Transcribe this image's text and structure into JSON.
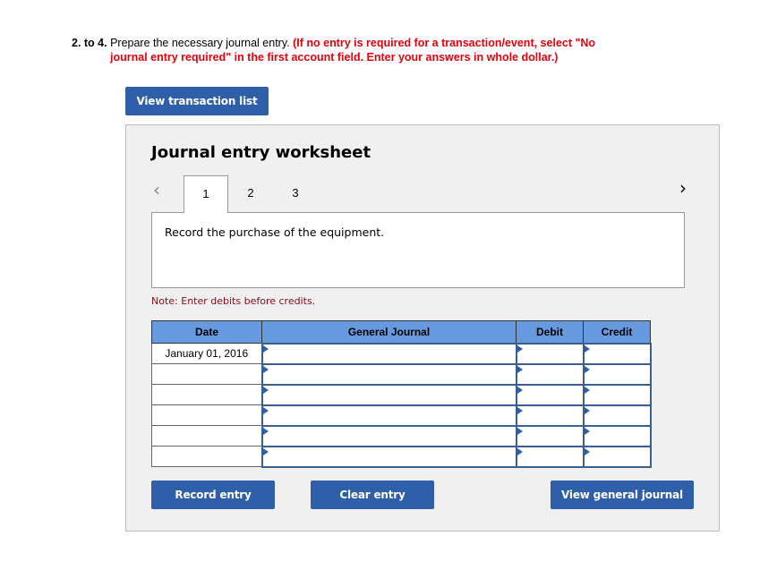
{
  "instructions": {
    "number": "2. to 4.",
    "text": " Prepare the necessary journal entry. ",
    "red_line1": "(If no entry is required for a transaction/event, select \"No",
    "red_line2": "journal entry required\" in the first account field. Enter your answers in whole dollar.)"
  },
  "buttons": {
    "view_transactions": "View transaction list",
    "record_entry": "Record entry",
    "clear_entry": "Clear entry",
    "view_general_journal": "View general journal"
  },
  "worksheet": {
    "title": "Journal entry worksheet",
    "nav_prev_icon": "chevron-left-icon",
    "nav_next_icon": "chevron-right-icon",
    "tabs": [
      {
        "label": "1",
        "active": true
      },
      {
        "label": "2",
        "active": false
      },
      {
        "label": "3",
        "active": false
      }
    ],
    "description": "Record the purchase of the equipment.",
    "note": "Note: Enter debits before credits."
  },
  "table": {
    "headers": [
      "Date",
      "General Journal",
      "Debit",
      "Credit"
    ],
    "rows": [
      {
        "date": "January 01, 2016",
        "account": "",
        "debit": "",
        "credit": ""
      },
      {
        "date": "",
        "account": "",
        "debit": "",
        "credit": ""
      },
      {
        "date": "",
        "account": "",
        "debit": "",
        "credit": ""
      },
      {
        "date": "",
        "account": "",
        "debit": "",
        "credit": ""
      },
      {
        "date": "",
        "account": "",
        "debit": "",
        "credit": ""
      },
      {
        "date": "",
        "account": "",
        "debit": "",
        "credit": ""
      }
    ]
  },
  "colors": {
    "button_blue": "#2e5fa8",
    "header_blue": "#6699dd",
    "instruction_red": "#e8000b",
    "note_red": "#8b0a1a"
  }
}
